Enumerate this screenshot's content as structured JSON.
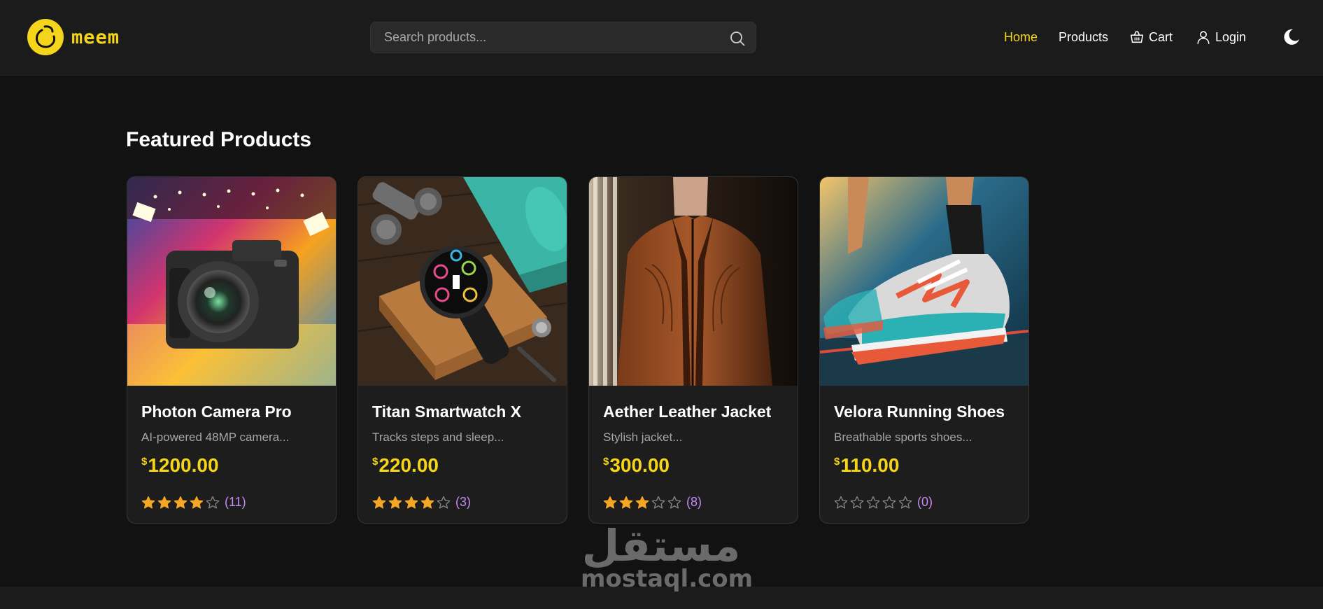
{
  "brand": {
    "name": "meem",
    "accent": "#f5d51b"
  },
  "search": {
    "placeholder": "Search products...",
    "value": ""
  },
  "nav": {
    "home": "Home",
    "products": "Products",
    "cart": "Cart",
    "login": "Login",
    "active": "home"
  },
  "icons": [
    "logo-icon",
    "search-icon",
    "cart-basket-icon",
    "user-icon",
    "moon-icon",
    "star-icon"
  ],
  "main": {
    "title": "Featured Products",
    "products": [
      {
        "name": "Photon Camera Pro",
        "description": "AI-powered 48MP camera...",
        "currency": "$",
        "price": "1200.00",
        "rating": 4,
        "reviews": "(11)",
        "image": "camera in colorful studio"
      },
      {
        "name": "Titan Smartwatch X",
        "description": "Tracks steps and sleep...",
        "currency": "$",
        "price": "220.00",
        "rating": 4,
        "reviews": "(3)",
        "image": "smartwatch on wooden block with dumbbells and yoga mat"
      },
      {
        "name": "Aether Leather Jacket",
        "description": "Stylish jacket...",
        "currency": "$",
        "price": "300.00",
        "rating": 3,
        "reviews": "(8)",
        "image": "brown leather jacket on mannequin"
      },
      {
        "name": "Velora Running Shoes",
        "description": "Breathable sports shoes...",
        "currency": "$",
        "price": "110.00",
        "rating": 0,
        "reviews": "(0)",
        "image": "colorful running shoe on track"
      }
    ]
  },
  "colors": {
    "star_filled": "#f5a623",
    "star_empty": "#8a8a8a",
    "review_count": "#c68af0"
  },
  "watermark": {
    "arabic": "مستقل",
    "latin": "mostaql.com"
  }
}
